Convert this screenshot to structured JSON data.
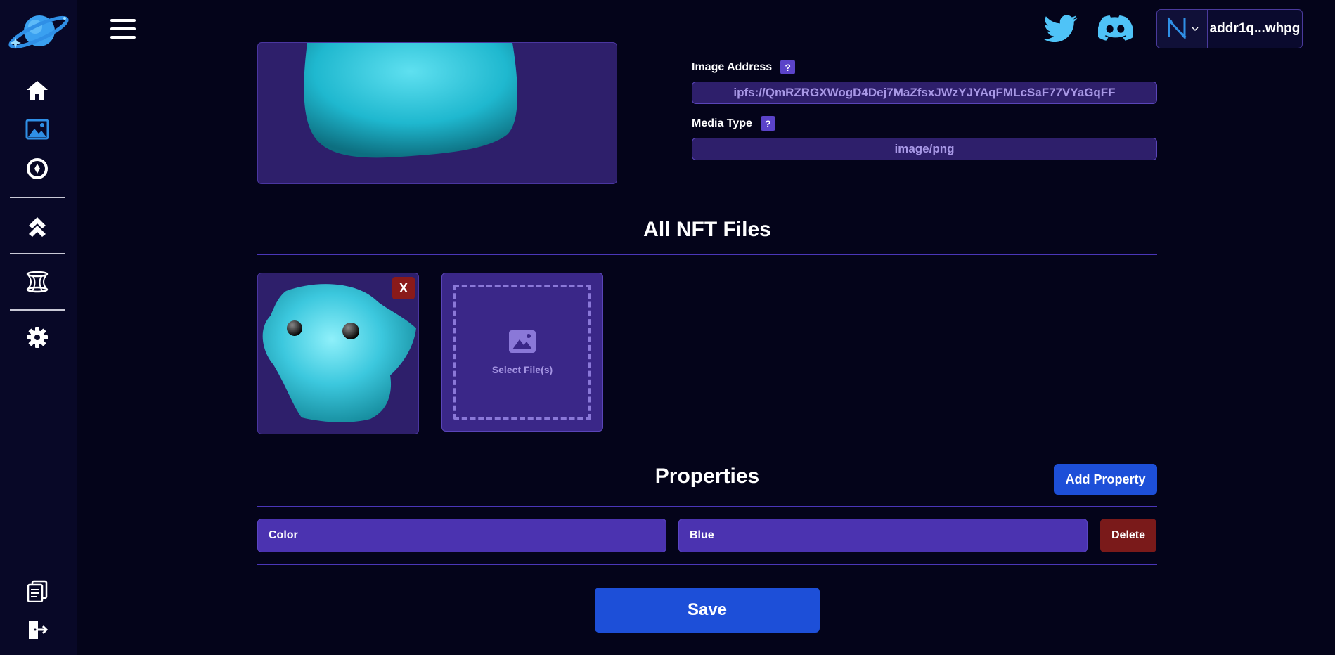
{
  "colors": {
    "background": "#04041a",
    "sidebar": "#080827",
    "accent_blue": "#1d4fd8",
    "danger": "#7a1a1a",
    "purple_field": "#2e1f6b",
    "property_field": "#4b33b0",
    "icon_cyan": "#4fd0f5"
  },
  "sidebar": {
    "logo_icon": "planet-logo-icon",
    "items": [
      {
        "icon": "home-icon"
      },
      {
        "icon": "image-icon"
      },
      {
        "icon": "compass-icon"
      },
      {
        "icon": "chevrons-up-icon"
      },
      {
        "icon": "hyperboloid-icon"
      },
      {
        "icon": "gear-icon"
      }
    ],
    "bottom_items": [
      {
        "icon": "documents-icon"
      },
      {
        "icon": "logout-icon"
      }
    ]
  },
  "topbar": {
    "menu_icon": "hamburger-icon",
    "social": [
      {
        "icon": "twitter-icon"
      },
      {
        "icon": "discord-icon"
      }
    ],
    "wallet": {
      "icon": "nami-wallet-icon",
      "address": "addr1q...whpg"
    }
  },
  "metadata": {
    "image_address_label": "Image Address",
    "image_address_value": "ipfs://QmRZRGXWogD4Dej7MaZfsxJWzYJYAqFMLcSaF77VYaGqFF",
    "media_type_label": "Media Type",
    "media_type_value": "image/png",
    "help_glyph": "?"
  },
  "files": {
    "title": "All NFT Files",
    "remove_label": "X",
    "upload_label": "Select File(s)"
  },
  "properties": {
    "title": "Properties",
    "add_label": "Add Property",
    "rows": [
      {
        "name": "Color",
        "value": "Blue",
        "delete_label": "Delete"
      }
    ]
  },
  "save_label": "Save"
}
